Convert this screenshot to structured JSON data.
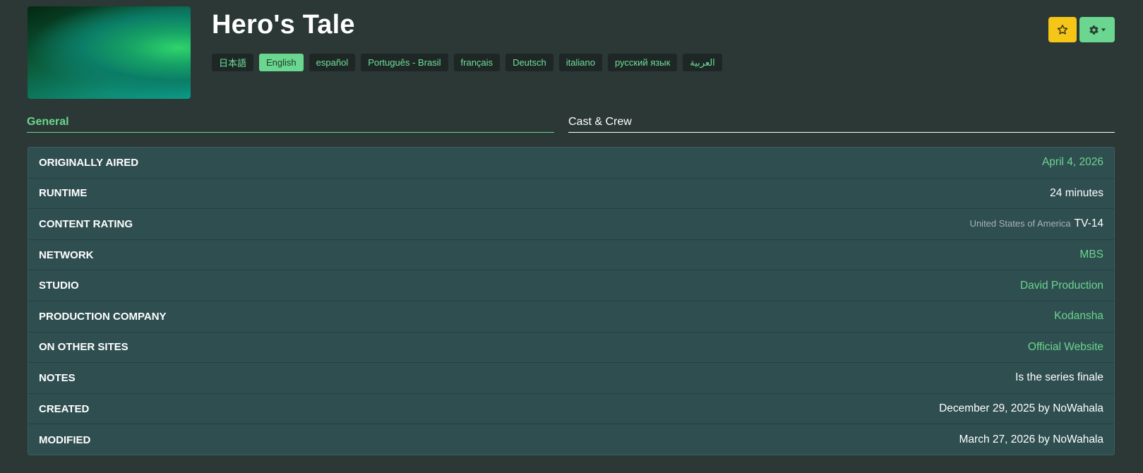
{
  "episode": {
    "title": "Hero's Tale"
  },
  "languages": [
    "日本語",
    "English",
    "español",
    "Português - Brasil",
    "français",
    "Deutsch",
    "italiano",
    "русский язык",
    "العربية"
  ],
  "active_language": "English",
  "actions": {
    "favorite_icon": "star-icon",
    "settings_icon": "gear-icon"
  },
  "tabs": {
    "general": "General",
    "cast_crew": "Cast & Crew"
  },
  "details": {
    "originally_aired": {
      "label": "ORIGINALLY AIRED",
      "value": "April 4, 2026"
    },
    "runtime": {
      "label": "RUNTIME",
      "value": "24 minutes"
    },
    "content_rating": {
      "label": "CONTENT RATING",
      "country": "United States of America",
      "value": "TV-14"
    },
    "network": {
      "label": "NETWORK",
      "value": "MBS"
    },
    "studio": {
      "label": "STUDIO",
      "value": "David Production"
    },
    "production_company": {
      "label": "PRODUCTION COMPANY",
      "value": "Kodansha"
    },
    "other_sites": {
      "label": "ON OTHER SITES",
      "value": "Official Website"
    },
    "notes": {
      "label": "NOTES",
      "value": "Is the series finale"
    },
    "created": {
      "label": "CREATED",
      "value": "December 29, 2025 by NoWahala"
    },
    "modified": {
      "label": "MODIFIED",
      "value": "March 27, 2026 by NoWahala"
    }
  },
  "colors": {
    "accent": "#6bd68f",
    "favorite": "#f5c518",
    "background": "#2b3835",
    "panel": "#2f4e50"
  }
}
